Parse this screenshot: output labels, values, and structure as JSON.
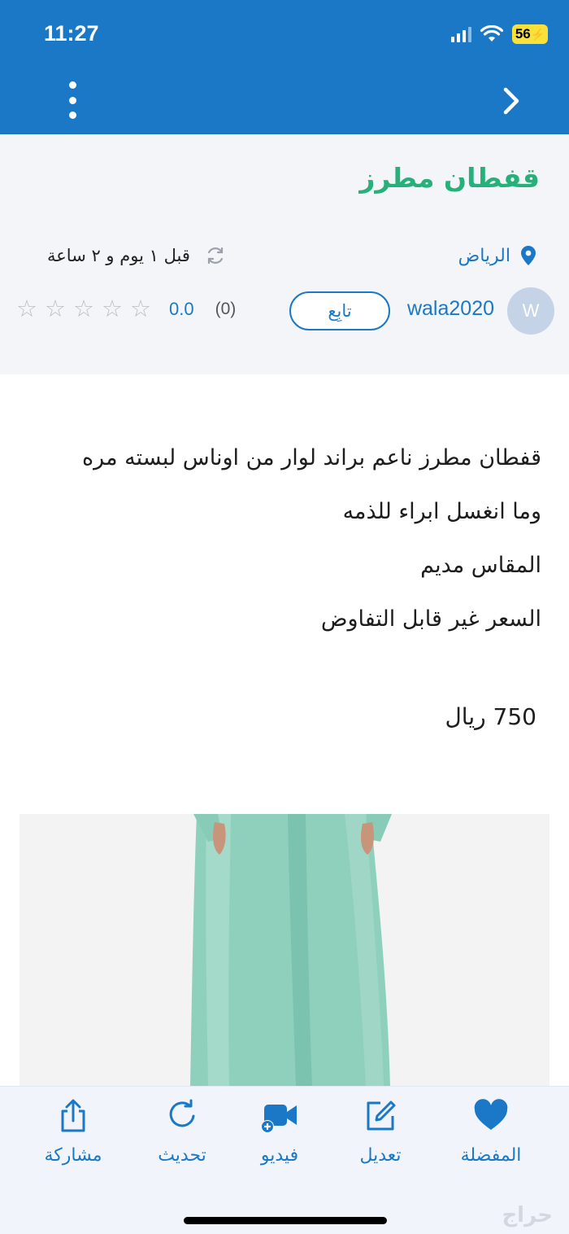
{
  "status_bar": {
    "time": "11:27",
    "battery": "56"
  },
  "ad": {
    "title": "قفطان مطرز",
    "city": "الرياض",
    "time_ago": "قبل ١ يوم و ٢ ساعة",
    "seller": {
      "avatar_letter": "W",
      "username": "wala2020",
      "follow_label": "تابِع"
    },
    "rating": {
      "value": "0.0",
      "count": "(0)",
      "stars": [
        "☆",
        "☆",
        "☆",
        "☆",
        "☆"
      ]
    },
    "description_lines": [
      "قفطان مطرز ناعم براند لوار من اوناس لبسته مره",
      "وما انغسل ابراء للذمه",
      "المقاس مديم",
      "السعر غير قابل التفاوض"
    ],
    "price": "750 ريال"
  },
  "bottom_bar": {
    "favorite": "المفضلة",
    "edit": "تعديل",
    "video": "فيديو",
    "refresh": "تحديث",
    "share": "مشاركة"
  },
  "colors": {
    "primary": "#1b78c6",
    "title_green": "#27b07a"
  },
  "watermark": "حراج"
}
